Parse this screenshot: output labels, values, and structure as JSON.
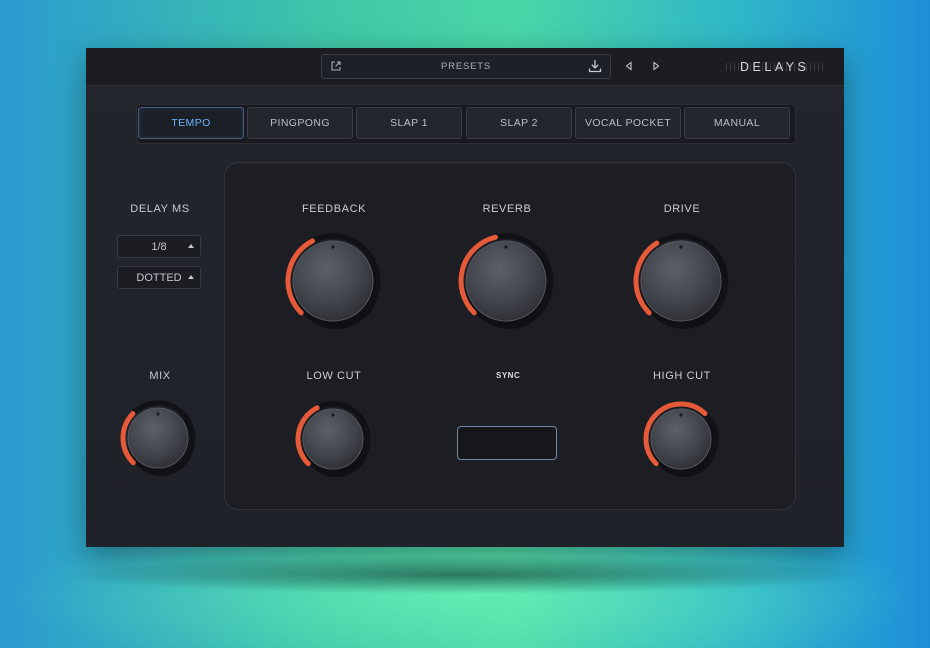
{
  "topbar": {
    "presets_label": "PRESETS",
    "brand": "DELAYS",
    "icons": [
      "external-link-icon",
      "download-icon",
      "prev-arrow-icon",
      "next-arrow-icon"
    ]
  },
  "modes": [
    {
      "label": "TEMPO",
      "active": true
    },
    {
      "label": "PINGPONG",
      "active": false
    },
    {
      "label": "SLAP 1",
      "active": false
    },
    {
      "label": "SLAP 2",
      "active": false
    },
    {
      "label": "VOCAL POCKET",
      "active": false
    },
    {
      "label": "MANUAL",
      "active": false
    }
  ],
  "delay": {
    "label": "DELAY MS",
    "division": "1/8",
    "type": "DOTTED"
  },
  "knobs": {
    "mix": {
      "label": "MIX",
      "value": 0.33
    },
    "feedback": {
      "label": "FEEDBACK",
      "value": 0.4
    },
    "reverb": {
      "label": "REVERB",
      "value": 0.45
    },
    "drive": {
      "label": "DRIVE",
      "value": 0.38
    },
    "low_cut": {
      "label": "LOW CUT",
      "value": 0.4
    },
    "high_cut": {
      "label": "HIGH CUT",
      "value": 0.66
    }
  },
  "center": {
    "sync_label": "SYNC"
  },
  "colors": {
    "accent": "#e65a3a",
    "active_tab": "#6cb4ff",
    "background": "#1f2228"
  }
}
